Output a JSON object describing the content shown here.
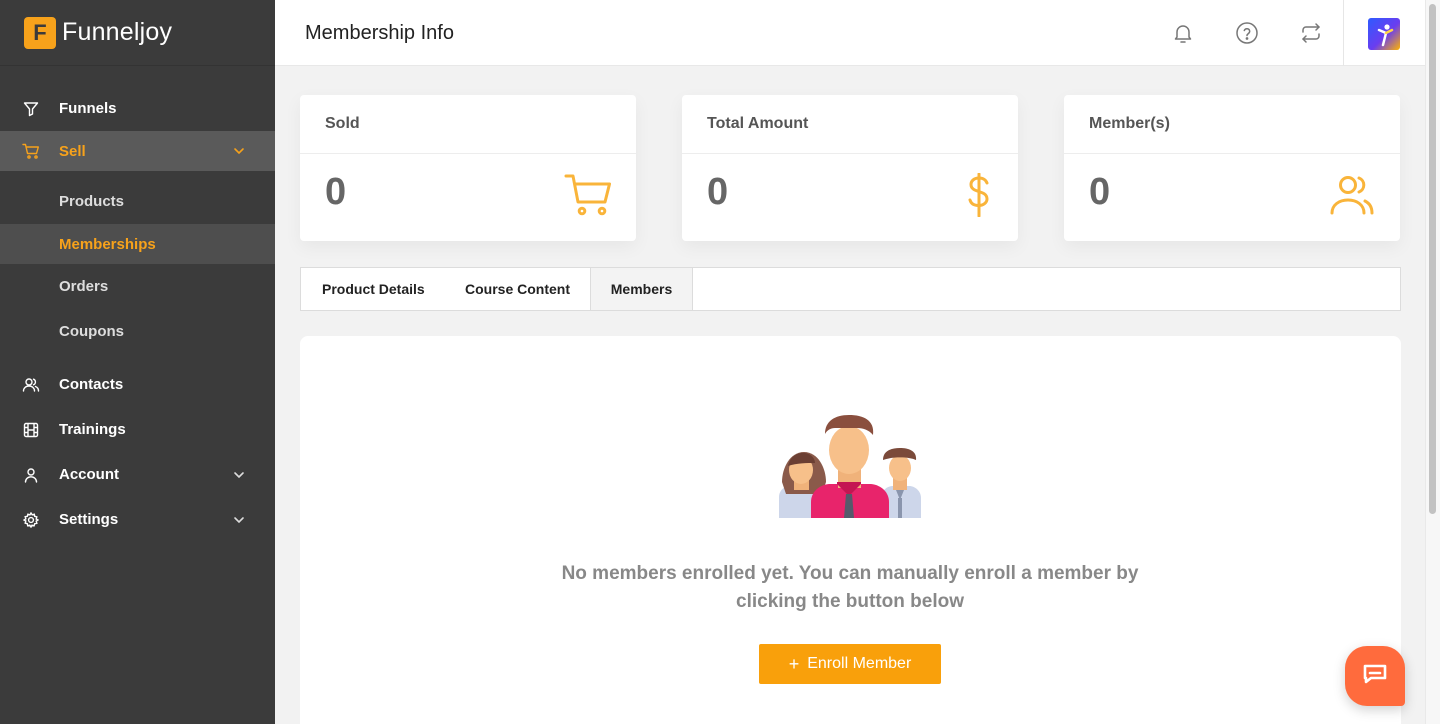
{
  "brand": {
    "logo_letter": "F",
    "name": "Funneljoy"
  },
  "sidebar": {
    "items": [
      {
        "label": "Funnels",
        "icon": "filter-icon"
      },
      {
        "label": "Sell",
        "icon": "cart-icon"
      },
      {
        "label": "Contacts",
        "icon": "users-icon"
      },
      {
        "label": "Trainings",
        "icon": "film-icon"
      },
      {
        "label": "Account",
        "icon": "user-icon"
      },
      {
        "label": "Settings",
        "icon": "gear-icon"
      }
    ],
    "sell_sub": [
      "Products",
      "Memberships",
      "Orders",
      "Coupons"
    ],
    "active_item": "Sell",
    "active_sub": "Memberships",
    "accent": "#f7a21b"
  },
  "header": {
    "title": "Membership Info"
  },
  "stats": [
    {
      "title": "Sold",
      "value": "0",
      "icon": "cart-icon"
    },
    {
      "title": "Total Amount",
      "value": "0",
      "icon": "dollar-icon"
    },
    {
      "title": "Member(s)",
      "value": "0",
      "icon": "users-icon"
    }
  ],
  "tabs": [
    {
      "label": "Product Details"
    },
    {
      "label": "Course Content"
    },
    {
      "label": "Members"
    }
  ],
  "active_tab": "Members",
  "members": {
    "empty_message": "No members enrolled yet. You can manually enroll a member by clicking the button below",
    "enroll_button": "Enroll Member",
    "button_color": "#f9a00b"
  }
}
